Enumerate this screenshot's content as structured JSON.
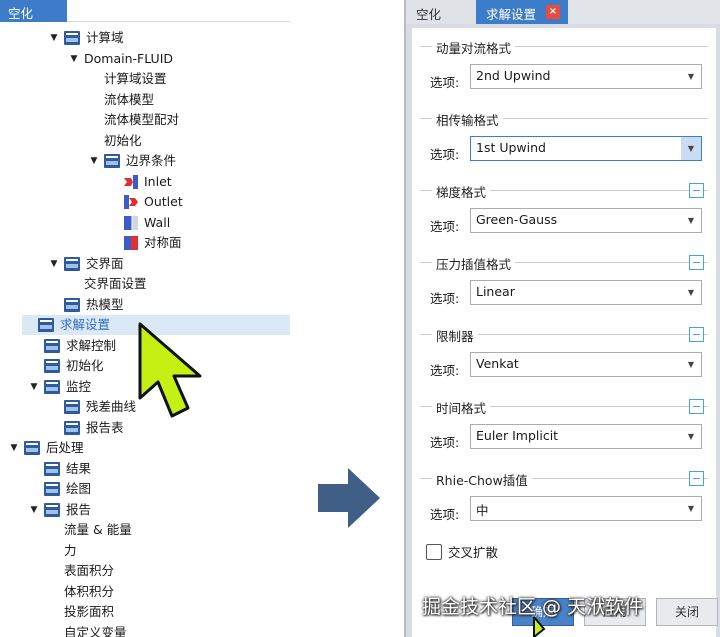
{
  "left_panel": {
    "title": "空化",
    "tree": [
      {
        "label": "计算域",
        "icon": "folder-icon",
        "caret": "▼"
      },
      {
        "label": "Domain-FLUID",
        "icon": "",
        "caret": "▼"
      },
      {
        "label": "计算域设置",
        "icon": "",
        "caret": ""
      },
      {
        "label": "流体模型",
        "icon": "",
        "caret": ""
      },
      {
        "label": "流体模型配对",
        "icon": "",
        "caret": ""
      },
      {
        "label": "初始化",
        "icon": "",
        "caret": ""
      },
      {
        "label": "边界条件",
        "icon": "folder-icon",
        "caret": "▼"
      },
      {
        "label": "Inlet",
        "icon": "inlet-icon",
        "caret": ""
      },
      {
        "label": "Outlet",
        "icon": "outlet-icon",
        "caret": ""
      },
      {
        "label": "Wall",
        "icon": "wall-icon",
        "caret": ""
      },
      {
        "label": "对称面",
        "icon": "symmetry-icon",
        "caret": ""
      },
      {
        "label": "交界面",
        "icon": "folder-icon",
        "caret": "▼"
      },
      {
        "label": "交界面设置",
        "icon": "",
        "caret": ""
      },
      {
        "label": "热模型",
        "icon": "folder-icon",
        "caret": ""
      },
      {
        "label": "求解设置",
        "icon": "folder-icon",
        "caret": "",
        "selected": true
      },
      {
        "label": "求解控制",
        "icon": "folder-icon",
        "caret": ""
      },
      {
        "label": "初始化",
        "icon": "folder-icon",
        "caret": ""
      },
      {
        "label": "监控",
        "icon": "folder-icon",
        "caret": "▼"
      },
      {
        "label": "残差曲线",
        "icon": "folder-icon",
        "caret": ""
      },
      {
        "label": "报告表",
        "icon": "folder-icon",
        "caret": ""
      },
      {
        "label": "后处理",
        "icon": "folder-icon",
        "caret": "▼"
      },
      {
        "label": "结果",
        "icon": "folder-icon",
        "caret": ""
      },
      {
        "label": "绘图",
        "icon": "folder-icon",
        "caret": ""
      },
      {
        "label": "报告",
        "icon": "folder-icon",
        "caret": "▼"
      },
      {
        "label": "流量 & 能量",
        "icon": "",
        "caret": ""
      },
      {
        "label": "力",
        "icon": "",
        "caret": ""
      },
      {
        "label": "表面积分",
        "icon": "",
        "caret": ""
      },
      {
        "label": "体积积分",
        "icon": "",
        "caret": ""
      },
      {
        "label": "投影面积",
        "icon": "",
        "caret": ""
      },
      {
        "label": "自定义变量",
        "icon": "",
        "caret": ""
      }
    ]
  },
  "right_panel": {
    "tabs": [
      {
        "label": "空化"
      },
      {
        "label": "求解设置"
      }
    ],
    "close_label": "×",
    "option_label": "选项:",
    "groups": [
      {
        "title": "动量对流格式",
        "value": "2nd Upwind",
        "collapsible": false
      },
      {
        "title": "相传输格式",
        "value": "1st Upwind",
        "collapsible": false,
        "focused": true
      },
      {
        "title": "梯度格式",
        "value": "Green-Gauss",
        "collapsible": true
      },
      {
        "title": "压力插值格式",
        "value": "Linear",
        "collapsible": true
      },
      {
        "title": "限制器",
        "value": "Venkat",
        "collapsible": true
      },
      {
        "title": "时间格式",
        "value": "Euler Implicit",
        "collapsible": true
      },
      {
        "title": "Rhie-Chow插值",
        "value": "中",
        "collapsible": true
      }
    ],
    "checkbox_label": "交叉扩散",
    "buttons": {
      "ok": "确定",
      "apply": "应用",
      "close": "关闭"
    }
  },
  "watermark": "掘金技术社区 @ 天洑软件",
  "colors": {
    "accent": "#3d7cc9",
    "selection": "#dbe9f7",
    "cursor_fill": "#c6f014",
    "arrow": "#3f5f86"
  }
}
